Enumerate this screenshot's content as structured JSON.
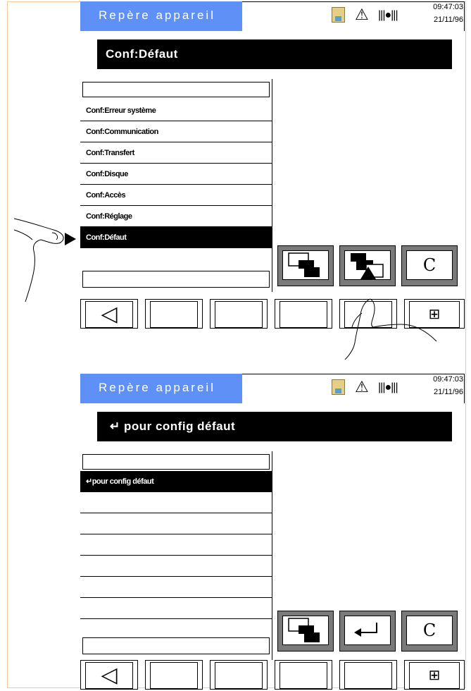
{
  "screens": [
    {
      "app_title": "Repère  appareil",
      "time": "09:47:03",
      "date": "21/11/96",
      "header": "Conf:Défaut",
      "rows": [
        "Conf:Erreur système",
        "Conf:Communication",
        "Conf:Transfert",
        "Conf:Disque",
        "Conf:Accès",
        "Conf:Réglage",
        "Conf:Défaut"
      ],
      "selected_index": 6,
      "softkeys": [
        "windows-back-icon",
        "windows-front-icon",
        "c-icon"
      ]
    },
    {
      "app_title": "Repère  appareil",
      "time": "09:47:03",
      "date": "21/11/96",
      "header": "↵ pour config défaut",
      "rows": [
        "↵pour config défaut",
        "",
        "",
        "",
        "",
        "",
        "",
        ""
      ],
      "selected_index": 0,
      "softkeys": [
        "windows-back-icon",
        "enter-icon",
        "c-icon"
      ]
    }
  ],
  "icons": {
    "disk": "floppy-disk-icon",
    "warning": "warning-triangle-icon",
    "signal": "signal-icon",
    "back": "back-triangle-icon",
    "window": "window-grid-icon"
  },
  "glyphs": {
    "warning": "⚠",
    "signal": "|||●|||",
    "back": "◁",
    "window": "⊞",
    "copyright": "C",
    "enter": "↵"
  }
}
